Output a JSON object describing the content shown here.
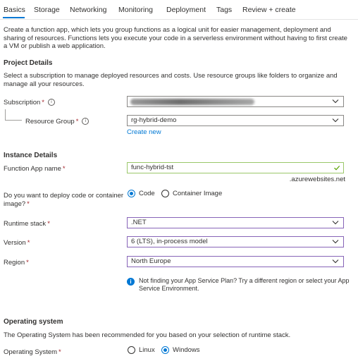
{
  "tabs": [
    "Basics",
    "Storage",
    "Networking",
    "Monitoring",
    "Deployment",
    "Tags",
    "Review + create"
  ],
  "intro": "Create a function app, which lets you group functions as a logical unit for easier management, deployment and sharing of resources. Functions lets you execute your code in a serverless environment without having to first create a VM or publish a web application.",
  "project": {
    "title": "Project Details",
    "desc": "Select a subscription to manage deployed resources and costs. Use resource groups like folders to organize and manage all your resources.",
    "subscription_label": "Subscription",
    "resource_group_label": "Resource Group",
    "resource_group_value": "rg-hybrid-demo",
    "create_new": "Create new"
  },
  "instance": {
    "title": "Instance Details",
    "app_name_label": "Function App name",
    "app_name_value": "func-hybrid-tst",
    "app_name_suffix": ".azurewebsites.net",
    "deploy_label": "Do you want to deploy code or container image?",
    "deploy_options": [
      "Code",
      "Container Image"
    ],
    "deploy_selected": "Code",
    "runtime_label": "Runtime stack",
    "runtime_value": ".NET",
    "version_label": "Version",
    "version_value": "6 (LTS), in-process model",
    "region_label": "Region",
    "region_value": "North Europe",
    "info_text": "Not finding your App Service Plan? Try a different region or select your App Service Environment."
  },
  "os": {
    "title": "Operating system",
    "desc": "The Operating System has been recommended for you based on your selection of runtime stack.",
    "label": "Operating System",
    "options": [
      "Linux",
      "Windows"
    ],
    "selected": "Windows"
  },
  "required_mark": "*",
  "colors": {
    "accent": "#0078d4",
    "required": "#a4262c",
    "purple_border": "#8764b8",
    "valid_border": "#9ac76a"
  },
  "icons": {
    "chevron": "chevron-down-icon",
    "check": "checkmark-icon",
    "info": "info-icon"
  }
}
